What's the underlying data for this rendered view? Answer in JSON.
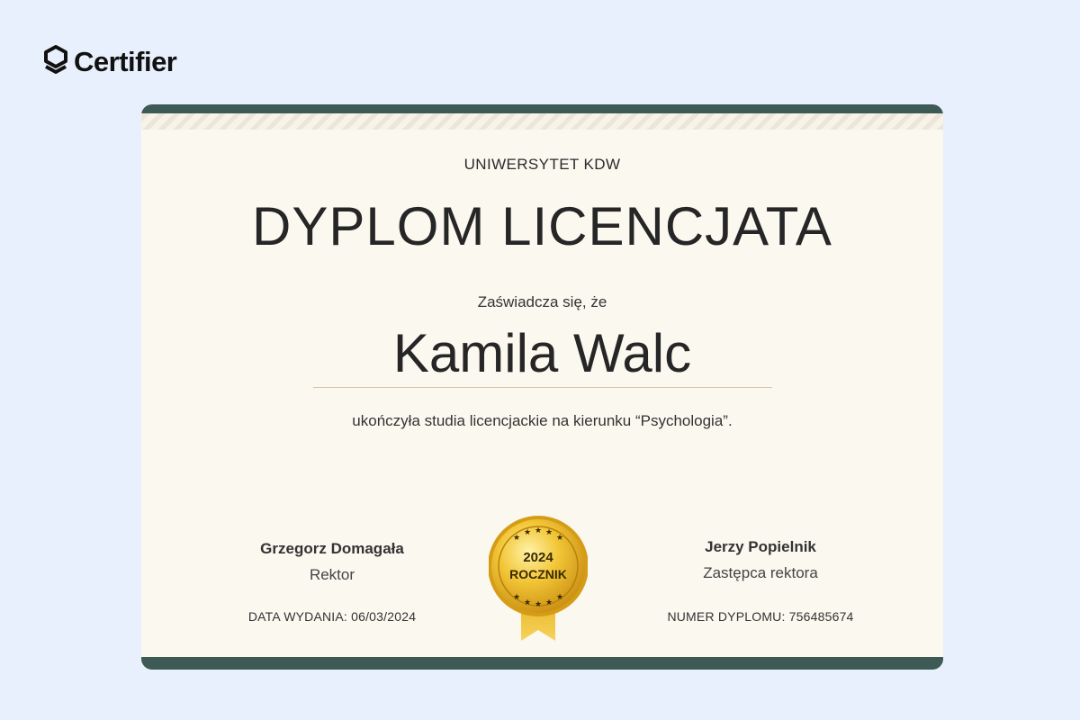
{
  "brand": {
    "name": "Certifier",
    "icon": "certifier-shield-logo",
    "color": "#111111"
  },
  "certificate": {
    "institution": "UNIWERSYTET KDW",
    "title": "DYPLOM LICENCJATA",
    "intro": "Zaświadcza się, że",
    "recipient": "Kamila Walc",
    "statement": "ukończyła studia licencjackie na kierunku “Psychologia”.",
    "colors": {
      "background": "#fbf8f0",
      "band": "#3d5a54",
      "name_line": "#d6c4a0",
      "page": "#e8f0fd"
    }
  },
  "signatories": {
    "left": {
      "name": "Grzegorz Domagała",
      "role": "Rektor"
    },
    "right": {
      "name": "Jerzy Popielnik",
      "role": "Zastępca rektora"
    }
  },
  "meta": {
    "issue_date": "DATA WYDANIA: 06/03/2024",
    "diploma_number": "NUMER DYPLOMU: 756485674"
  },
  "seal": {
    "year": "2024",
    "label": "ROCZNIK",
    "icon": "gold-medal-badge",
    "colors": {
      "gold": "#e8b62c",
      "ribbon": "#f0c63d",
      "text": "#3a2a00"
    }
  }
}
